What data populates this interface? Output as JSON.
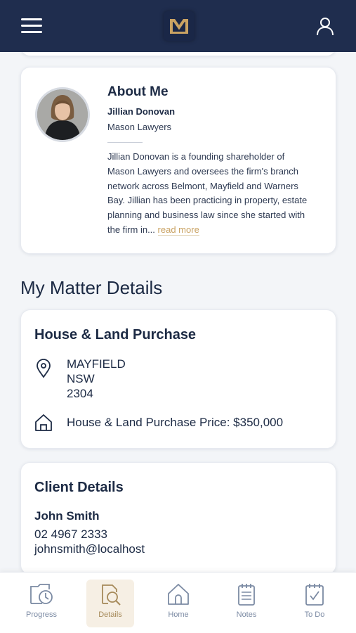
{
  "header": {
    "logo_letter": "M",
    "menu_icon": "hamburger-menu-icon",
    "account_icon": "user-account-icon"
  },
  "about": {
    "title": "About Me",
    "name": "Jillian Donovan",
    "firm": "Mason Lawyers",
    "bio_line1": "Jillian Donovan is a founding shareholder of",
    "bio_line2": "Mason Lawyers and oversees the firm's branch",
    "bio_line3": "network across Belmont, Mayfield and Warners",
    "bio_line4": "Bay. Jillian has been practicing in property, estate",
    "bio_line5": "planning and business law since she started with",
    "bio_line6": "the firm in...",
    "read_more": "read more"
  },
  "section_title": "My Matter Details",
  "matter": {
    "title": "House & Land Purchase",
    "suburb": "MAYFIELD",
    "state": "NSW",
    "postcode": "2304",
    "price_text": "House & Land Purchase Price: $350,000"
  },
  "client": {
    "title": "Client Details",
    "name": "John Smith",
    "phone": "02 4967 2333",
    "email": "johnsmith@localhost"
  },
  "tabs": [
    {
      "label": "Progress",
      "icon": "progress-clock-icon",
      "active": false
    },
    {
      "label": "Details",
      "icon": "details-search-icon",
      "active": true
    },
    {
      "label": "Home",
      "icon": "home-icon",
      "active": false
    },
    {
      "label": "Notes",
      "icon": "notes-icon",
      "active": false
    },
    {
      "label": "To Do",
      "icon": "todo-checklist-icon",
      "active": false
    }
  ],
  "colors": {
    "navy": "#1f2d4e",
    "gold": "#c9a262",
    "tab_inactive": "#7b8aa3",
    "tab_active_bg": "#f6efe4"
  }
}
